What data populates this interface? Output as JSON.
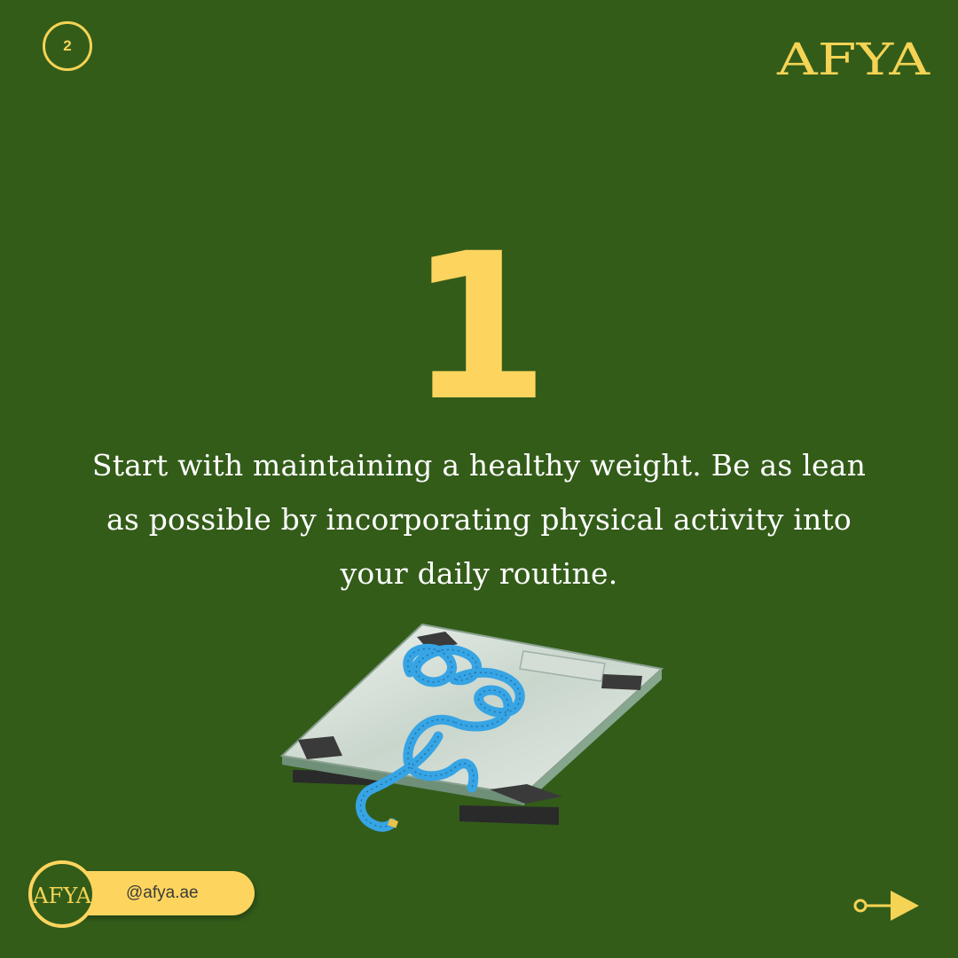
{
  "header": {
    "page_number": "2",
    "brand_name": "AFYA"
  },
  "main": {
    "step_number": "1",
    "tip_text": "Start with maintaining a healthy weight. Be as lean as possible by incorporating physical activity into your daily routine."
  },
  "footer": {
    "avatar_brand": "AFYA",
    "handle": "@afya.ae",
    "next_icon": "arrow-right-icon"
  },
  "colors": {
    "background": "#335c19",
    "accent": "#f5d354",
    "text": "#ffffff"
  }
}
